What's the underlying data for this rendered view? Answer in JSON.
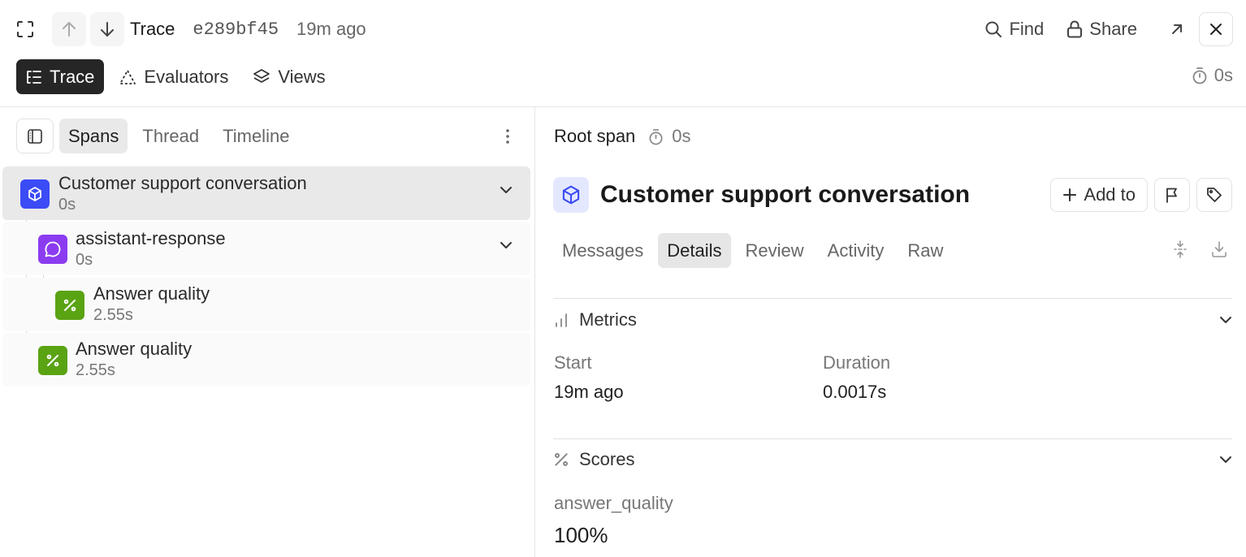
{
  "header": {
    "title": "Trace",
    "trace_id": "e289bf45",
    "age": "19m ago",
    "find_label": "Find",
    "share_label": "Share"
  },
  "modes": [
    {
      "label": "Trace",
      "active": true
    },
    {
      "label": "Evaluators",
      "active": false
    },
    {
      "label": "Views",
      "active": false
    }
  ],
  "top_timer": "0s",
  "left_tabs": [
    {
      "label": "Spans",
      "active": true
    },
    {
      "label": "Thread",
      "active": false
    },
    {
      "label": "Timeline",
      "active": false
    }
  ],
  "spans": [
    {
      "name": "Customer support conversation",
      "duration": "0s",
      "icon": "cube-icon",
      "color": "#3b4bf5",
      "selected": true,
      "expandable": true
    },
    {
      "name": "assistant-response",
      "duration": "0s",
      "icon": "chat-bubble-icon",
      "color": "#8b3cf0",
      "selected": false,
      "expandable": true
    },
    {
      "name": "Answer quality",
      "duration": "2.55s",
      "icon": "percent-icon",
      "color": "#5aa313",
      "selected": false,
      "expandable": false
    },
    {
      "name": "Answer quality",
      "duration": "2.55s",
      "icon": "percent-icon",
      "color": "#5aa313",
      "selected": false,
      "expandable": false
    }
  ],
  "detail": {
    "root_label": "Root span",
    "root_time": "0s",
    "title": "Customer support conversation",
    "add_to_label": "Add to",
    "tabs": [
      {
        "label": "Messages",
        "active": false
      },
      {
        "label": "Details",
        "active": true
      },
      {
        "label": "Review",
        "active": false
      },
      {
        "label": "Activity",
        "active": false
      },
      {
        "label": "Raw",
        "active": false
      }
    ],
    "metrics": {
      "heading": "Metrics",
      "start_label": "Start",
      "start_value": "19m ago",
      "duration_label": "Duration",
      "duration_value": "0.0017s"
    },
    "scores": {
      "heading": "Scores",
      "name": "answer_quality",
      "value": "100%"
    }
  },
  "colors": {
    "accent_dark": "#262626",
    "root_blue": "#3b4bf5",
    "llm_purple": "#8b3cf0",
    "score_green": "#5aa313"
  }
}
